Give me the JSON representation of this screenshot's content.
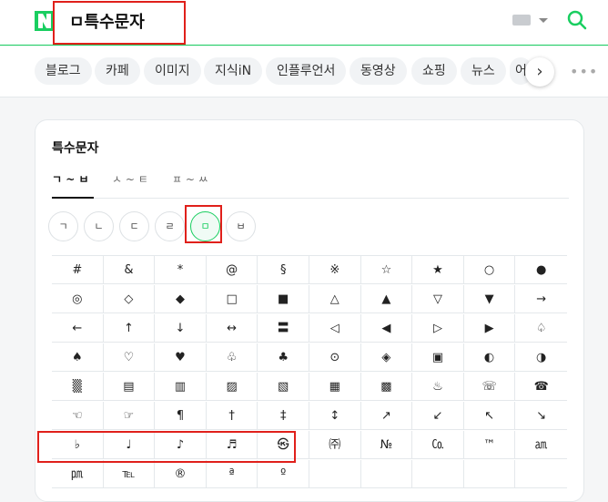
{
  "header": {
    "query": "ㅁ특수문자"
  },
  "tabs": [
    "블로그",
    "카페",
    "이미지",
    "지식iN",
    "인플루언서",
    "동영상",
    "쇼핑",
    "뉴스",
    "어"
  ],
  "card": {
    "title": "특수문자",
    "ranges": [
      "ㄱ ~ ㅂ",
      "ㅅ ~ ㅌ",
      "ㅍ ~ ㅆ"
    ],
    "consonants": [
      "ㄱ",
      "ㄴ",
      "ㄷ",
      "ㄹ",
      "ㅁ",
      "ㅂ"
    ],
    "active_consonant": "ㅁ",
    "rows": [
      [
        "#",
        "&",
        "*",
        "@",
        "§",
        "※",
        "☆",
        "★",
        "○",
        "●"
      ],
      [
        "◎",
        "◇",
        "◆",
        "□",
        "■",
        "△",
        "▲",
        "▽",
        "▼",
        "→"
      ],
      [
        "←",
        "↑",
        "↓",
        "↔",
        "〓",
        "◁",
        "◀",
        "▷",
        "▶",
        "♤"
      ],
      [
        "♠",
        "♡",
        "♥",
        "♧",
        "♣",
        "⊙",
        "◈",
        "▣",
        "◐",
        "◑"
      ],
      [
        "▒",
        "▤",
        "▥",
        "▨",
        "▧",
        "▦",
        "▩",
        "♨",
        "☏",
        "☎"
      ],
      [
        "☜",
        "☞",
        "¶",
        "†",
        "‡",
        "↕",
        "↗",
        "↙",
        "↖",
        "↘"
      ],
      [
        "♭",
        "♩",
        "♪",
        "♬",
        "㉿",
        "㈜",
        "№",
        "㏇",
        "™",
        "㏂"
      ],
      [
        "㏘",
        "℡",
        "®",
        "ª",
        "º",
        "",
        "",
        "",
        "",
        ""
      ]
    ]
  },
  "colors": {
    "brand_green": "#19ce60",
    "highlight_red": "#e0201b"
  }
}
